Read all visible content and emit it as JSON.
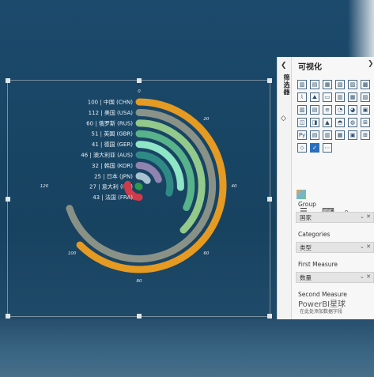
{
  "chart_data": {
    "type": "radial-bar",
    "axis_ticks": [
      "0",
      "20",
      "40",
      "60",
      "80",
      "100",
      "120"
    ],
    "categories": [
      {
        "label": "100 | 中国 (CHN)",
        "value": 100,
        "color": "#e59a22"
      },
      {
        "label": "112 | 美国 (USA)",
        "value": 112,
        "color": "#e8d2a6"
      },
      {
        "label": "60 | 俄罗斯 (RUS)",
        "value": 60,
        "color": "#93c98a"
      },
      {
        "label": "51 | 英国 (GBR)",
        "value": 51,
        "color": "#58b28a"
      },
      {
        "label": "41 | 德国 (GER)",
        "value": 41,
        "color": "#8ee6c6"
      },
      {
        "label": "46 | 澳大利亚 (AUS)",
        "value": 46,
        "color": "#2f8a86"
      },
      {
        "label": "32 | 韩国 (KOR)",
        "value": 32,
        "color": "#8f83b0"
      },
      {
        "label": "25 | 日本 (JPN)",
        "value": 25,
        "color": "#a9c3d0"
      },
      {
        "label": "27 | 意大利 (ITA)",
        "value": 27,
        "color": "#2e9a4a"
      },
      {
        "label": "43 | 法国 (FRA)",
        "value": 43,
        "color": "#cf3b4a"
      }
    ],
    "max_value": 120
  },
  "filters_pane": {
    "label": "筛选器"
  },
  "viz_pane": {
    "title": "可视化",
    "wells": [
      {
        "section": "Group",
        "value": "国家"
      },
      {
        "section": "Categories",
        "value": "类型"
      },
      {
        "section": "First Measure",
        "value": "数量"
      },
      {
        "section": "Second Measure",
        "value": ""
      }
    ]
  },
  "watermark": {
    "line1": "PowerBI星球",
    "line2": "在此处添加数据字段"
  }
}
